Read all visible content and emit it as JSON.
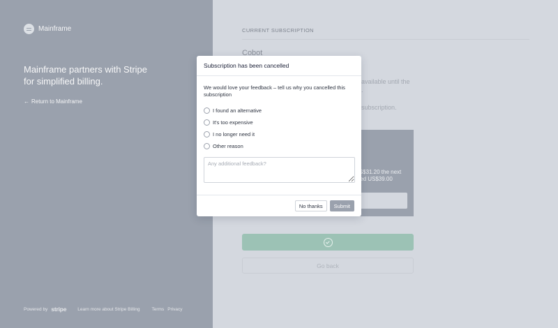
{
  "brand": {
    "name": "Mainframe",
    "logo_icon": "mainframe-logo-icon"
  },
  "left_panel": {
    "tagline": "Mainframe partners with Stripe for simplified billing.",
    "return_link": "Return to Mainframe",
    "return_icon": "arrow-left-icon"
  },
  "footer": {
    "powered_by": "Powered by",
    "stripe": "stripe",
    "learn_more": "Learn more about Stripe Billing",
    "terms": "Terms",
    "privacy": "Privacy"
  },
  "main": {
    "section_label": "CURRENT SUBSCRIPTION",
    "plan_name": "Cobot",
    "bg_line_1a": "available until the",
    "bg_line_1b": ".",
    "bg_line_2": "subscription.",
    "card_line_1": "US$31.20 the next",
    "card_line_2": "rged US$39.00",
    "confirm_icon": "check-circle-icon",
    "back_label": "Go back"
  },
  "modal": {
    "title": "Subscription has been cancelled",
    "prompt": "We would love your feedback – tell us why you cancelled this subscription",
    "options": [
      {
        "label": "I found an alternative"
      },
      {
        "label": "It's too expensive"
      },
      {
        "label": "I no longer need it"
      },
      {
        "label": "Other reason"
      }
    ],
    "feedback_placeholder": "Any additional feedback?",
    "no_thanks": "No thanks",
    "submit": "Submit"
  },
  "colors": {
    "left_panel_bg": "#9aa1ad",
    "overlay_bg": "#d4d8df",
    "confirm_green": "#9cc2b5",
    "submit_gray": "#9aa1ad"
  }
}
